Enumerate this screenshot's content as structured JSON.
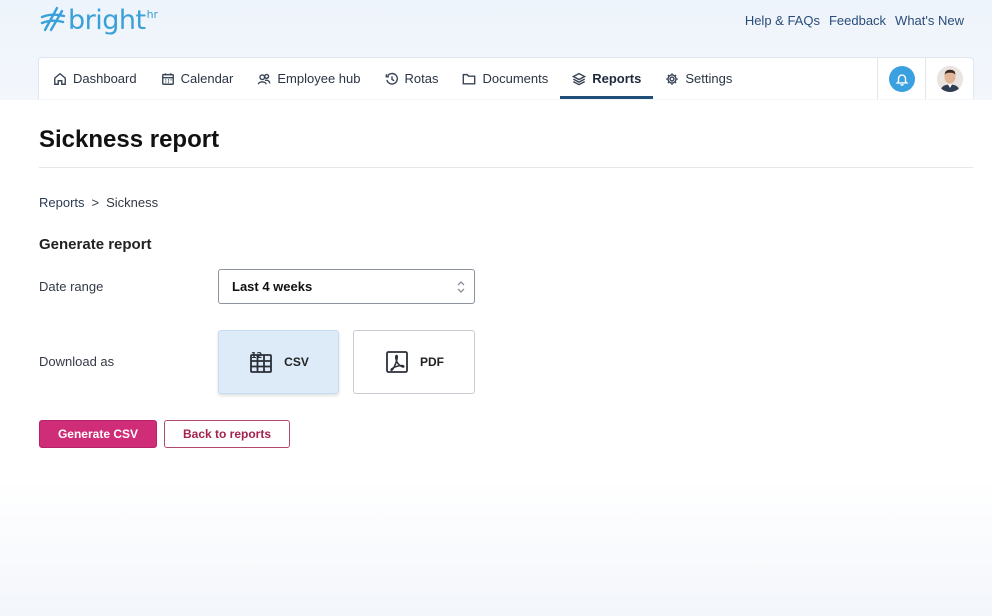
{
  "brand": {
    "name": "bright",
    "suffix": "hr",
    "color": "#3aa0d8"
  },
  "top_links": [
    {
      "label": "Help & FAQs"
    },
    {
      "label": "Feedback"
    },
    {
      "label": "What's New"
    }
  ],
  "nav": {
    "items": [
      {
        "label": "Dashboard",
        "icon": "home-icon"
      },
      {
        "label": "Calendar",
        "icon": "calendar-icon"
      },
      {
        "label": "Employee hub",
        "icon": "people-icon"
      },
      {
        "label": "Rotas",
        "icon": "clock-history-icon"
      },
      {
        "label": "Documents",
        "icon": "folder-icon"
      },
      {
        "label": "Reports",
        "icon": "layers-icon",
        "active": true
      },
      {
        "label": "Settings",
        "icon": "gear-icon"
      }
    ],
    "active_color": "#1f4e79",
    "bell_color": "#3aa0e0"
  },
  "page": {
    "title": "Sickness report",
    "breadcrumb": {
      "parent": "Reports",
      "separator": ">",
      "current": "Sickness"
    }
  },
  "form": {
    "section_title": "Generate report",
    "date_range": {
      "label": "Date range",
      "value": "Last 4 weeks"
    },
    "download": {
      "label": "Download as",
      "options": [
        {
          "label": "CSV",
          "icon": "spreadsheet-icon",
          "selected": true
        },
        {
          "label": "PDF",
          "icon": "pdf-icon",
          "selected": false
        }
      ]
    },
    "actions": {
      "primary": "Generate CSV",
      "secondary": "Back to reports",
      "primary_color": "#cf2d78"
    }
  }
}
